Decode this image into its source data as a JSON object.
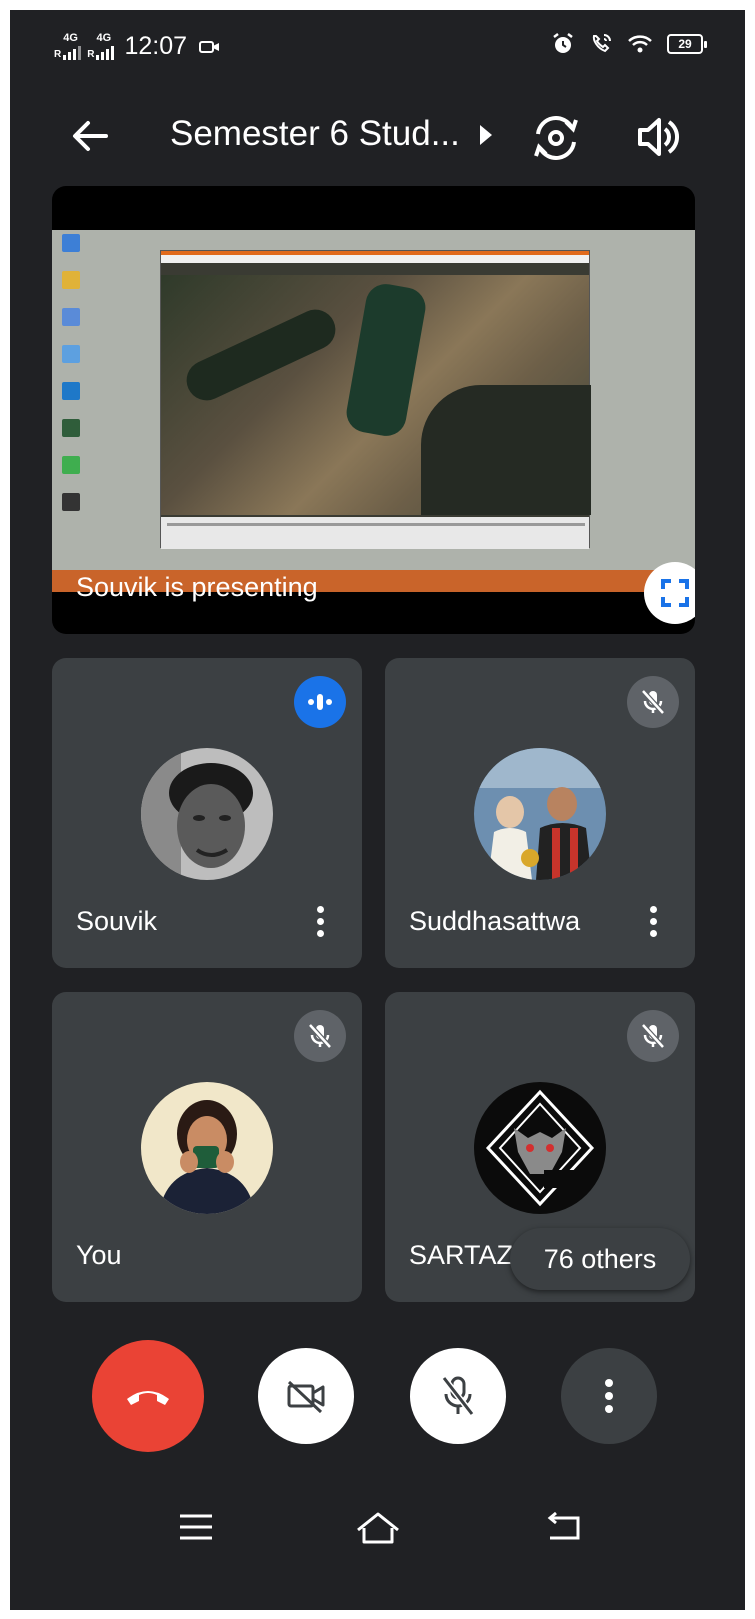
{
  "status_bar": {
    "carrier1": "R",
    "carrier2": "R",
    "network1": "4G",
    "network2": "4G",
    "time": "12:07",
    "battery": "29"
  },
  "header": {
    "meeting_title": "Semester 6 Stud..."
  },
  "presentation": {
    "label": "Souvik is presenting"
  },
  "participants": [
    {
      "name": "Souvik",
      "state": "speaking",
      "has_menu": true
    },
    {
      "name": "Suddhasattwa",
      "state": "muted",
      "has_menu": true
    },
    {
      "name": "You",
      "state": "muted",
      "has_menu": false
    },
    {
      "name": "SARTAZ",
      "state": "muted",
      "has_menu": false
    }
  ],
  "others_label": "76 others",
  "colors": {
    "background": "#202124",
    "tile": "#3c4043",
    "end_call": "#ea4335",
    "speaking": "#1a73e8",
    "muted_badge": "#5f6368"
  }
}
